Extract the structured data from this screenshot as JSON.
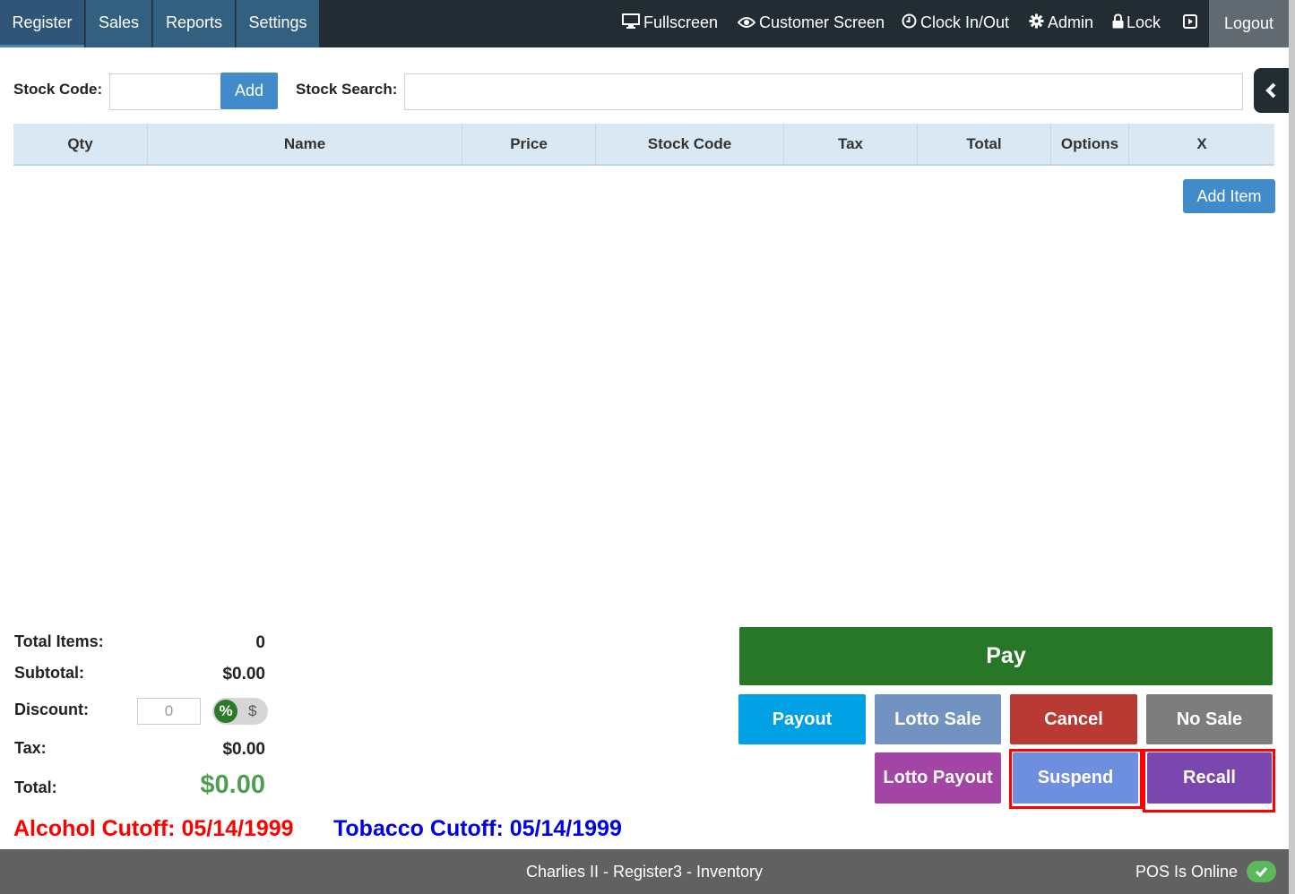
{
  "nav": {
    "tabs": [
      {
        "label": "Register"
      },
      {
        "label": "Sales"
      },
      {
        "label": "Reports"
      },
      {
        "label": "Settings"
      }
    ],
    "fullscreen": "Fullscreen",
    "customer_screen": "Customer Screen",
    "clock": "Clock In/Out",
    "admin": "Admin",
    "lock": "Lock",
    "logout": "Logout"
  },
  "stock": {
    "code_label": "Stock Code:",
    "code_value": "",
    "add_label": "Add",
    "search_label": "Stock Search:",
    "search_value": ""
  },
  "table": {
    "columns": [
      "Qty",
      "Name",
      "Price",
      "Stock Code",
      "Tax",
      "Total",
      "Options",
      "X"
    ],
    "rows": []
  },
  "add_item_label": "Add Item",
  "totals": {
    "items_label": "Total Items:",
    "items_value": "0",
    "subtotal_label": "Subtotal:",
    "subtotal_value": "$0.00",
    "discount_label": "Discount:",
    "discount_placeholder": "0",
    "discount_mode_percent": "%",
    "discount_mode_dollar": "$",
    "tax_label": "Tax:",
    "tax_value": "$0.00",
    "total_label": "Total:",
    "total_value": "$0.00"
  },
  "cutoffs": {
    "alcohol": "Alcohol Cutoff: 05/14/1999",
    "tobacco": "Tobacco Cutoff: 05/14/1999"
  },
  "actions": {
    "pay": "Pay",
    "payout": "Payout",
    "lotto_sale": "Lotto Sale",
    "cancel": "Cancel",
    "no_sale": "No Sale",
    "lotto_payout": "Lotto Payout",
    "suspend": "Suspend",
    "recall": "Recall"
  },
  "colors": {
    "pay": "#287627",
    "payout": "#00a0e4",
    "lotto_sale": "#7293c2",
    "cancel": "#b83a32",
    "no_sale": "#7d7d7d",
    "lotto_payout": "#a245a5",
    "suspend": "#6e8ee0",
    "recall": "#7b46ae",
    "alcohol": "#ff0000",
    "tobacco": "#0000e6"
  },
  "footer": {
    "center": "Charlies II - Register3 - Inventory",
    "status": "POS Is Online"
  }
}
